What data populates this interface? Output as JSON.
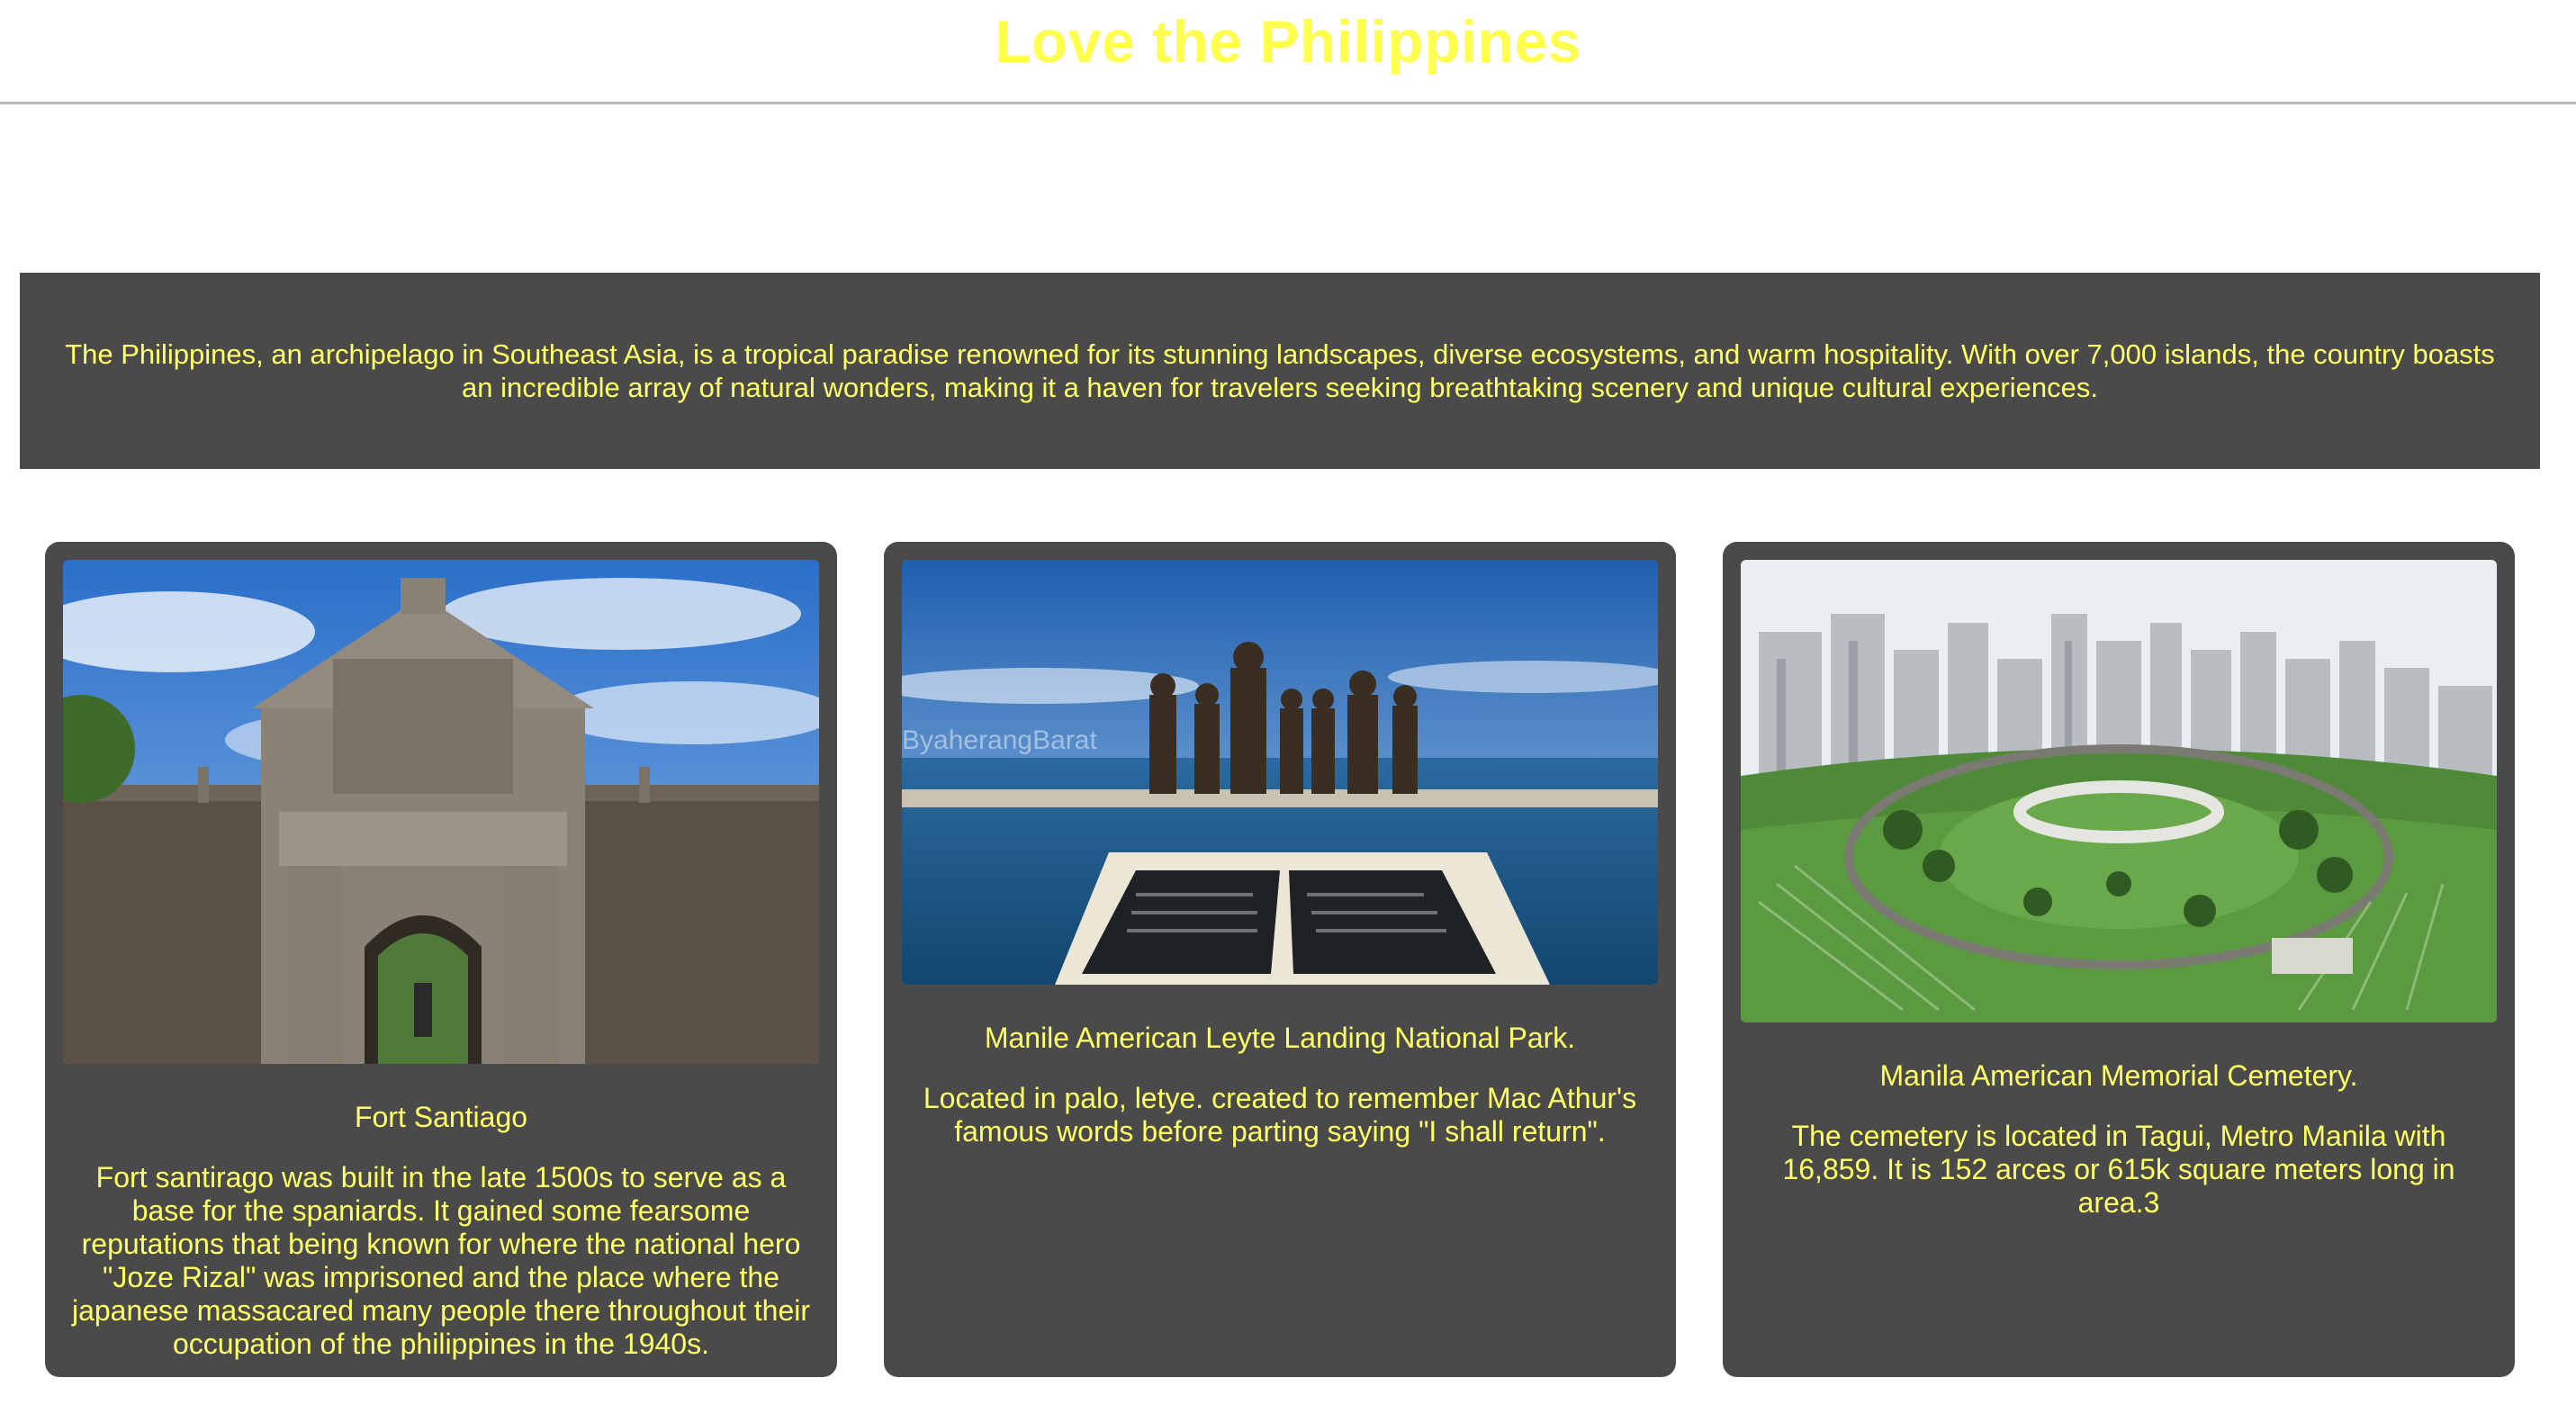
{
  "header": {
    "title": "Love the Philippines"
  },
  "intro": {
    "text": "The Philippines, an archipelago in Southeast Asia, is a tropical paradise renowned for its stunning landscapes, diverse ecosystems, and warm hospitality. With over 7,000 islands, the country boasts an incredible array of natural wonders, making it a haven for travelers seeking breathtaking scenery and unique cultural experiences."
  },
  "cards": [
    {
      "title": "Fort Santiago",
      "description": "Fort santirago was built in the late 1500s to serve as a base for the spaniards. It gained some fearsome reputations that being known for where the national hero \"Joze Rizal\" was imprisoned and the place where the japanese massacared many people there throughout their occupation of the philippines in the 1940s."
    },
    {
      "title": "Manile American Leyte Landing National Park.",
      "description": "Located in palo, letye. created to remember Mac Athur's famous words before parting saying \"I shall return\".",
      "photo_watermark": "ByaherangBarat"
    },
    {
      "title": "Manila American Memorial Cemetery.",
      "description": "The cemetery is located in Tagui, Metro Manila with 16,859. It is 152 arces or 615k square meters long in area.3"
    }
  ],
  "colors": {
    "accent_text": "#ffff66",
    "panel_bg": "#4a4a4a",
    "page_bg": "#ffffff"
  }
}
